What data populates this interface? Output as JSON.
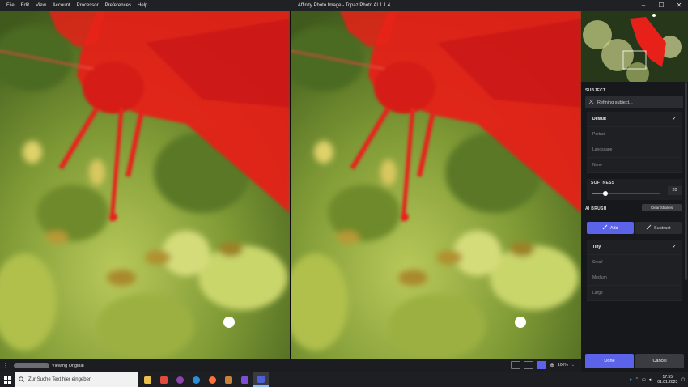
{
  "window": {
    "title": "Affinity Photo Image - Topaz Photo AI 1.1.4",
    "menu": [
      "File",
      "Edit",
      "View",
      "Account",
      "Processor",
      "Preferences",
      "Help"
    ],
    "controls": [
      "–",
      "☐",
      "✕"
    ]
  },
  "panel": {
    "subject_label": "SUBJECT",
    "refining_text": "Refining subject...",
    "subject_options": [
      {
        "label": "Default",
        "selected": true
      },
      {
        "label": "Portrait",
        "selected": false
      },
      {
        "label": "Landscape",
        "selected": false
      },
      {
        "label": "None",
        "selected": false
      }
    ],
    "softness_label": "SOFTNESS",
    "softness_value": "20",
    "softness_fraction": 0.2,
    "ai_brush_label": "AI BRUSH",
    "clear_strokes_label": "Clear Strokes",
    "add_label": "Add",
    "subtract_label": "Subtract",
    "brush_sizes": [
      {
        "label": "Tiny",
        "selected": true
      },
      {
        "label": "Small",
        "selected": false
      },
      {
        "label": "Medium",
        "selected": false
      },
      {
        "label": "Large",
        "selected": false
      }
    ],
    "done_label": "Done",
    "cancel_label": "Cancel"
  },
  "statusbar": {
    "viewing_text": "Viewing Original",
    "zoom": "100%"
  },
  "taskbar": {
    "search_placeholder": "Zur Suche Text hier eingeben",
    "time": "17:55",
    "date": "01.01.2023"
  },
  "colors": {
    "accent": "#5b63e8",
    "mask_red": "#e8201a"
  }
}
